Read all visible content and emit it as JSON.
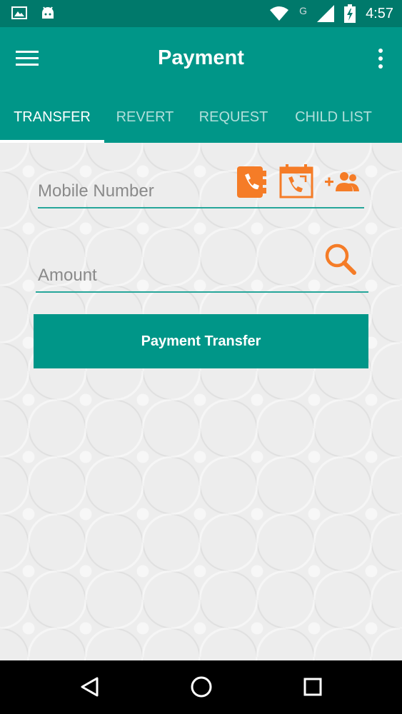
{
  "status_bar": {
    "time": "4:57",
    "network_label": "G",
    "icons": [
      "image-icon",
      "android-icon",
      "wifi-icon",
      "signal-icon",
      "battery-charging-icon"
    ]
  },
  "app_bar": {
    "title": "Payment",
    "menu_icon": "hamburger-menu-icon",
    "overflow_icon": "more-vertical-icon"
  },
  "tabs": [
    {
      "label": "TRANSFER",
      "active": true
    },
    {
      "label": "REVERT",
      "active": false
    },
    {
      "label": "REQUEST",
      "active": false
    },
    {
      "label": "CHILD LIST",
      "active": false
    }
  ],
  "form": {
    "mobile_placeholder": "Mobile Number",
    "mobile_value": "",
    "amount_placeholder": "Amount",
    "amount_value": "",
    "submit_label": "Payment Transfer"
  },
  "colors": {
    "primary": "#009688",
    "primary_dark": "#00796b",
    "accent_orange": "#f57c27"
  },
  "nav_bar": {
    "icons": [
      "back-triangle-icon",
      "home-circle-icon",
      "recents-square-icon"
    ]
  }
}
